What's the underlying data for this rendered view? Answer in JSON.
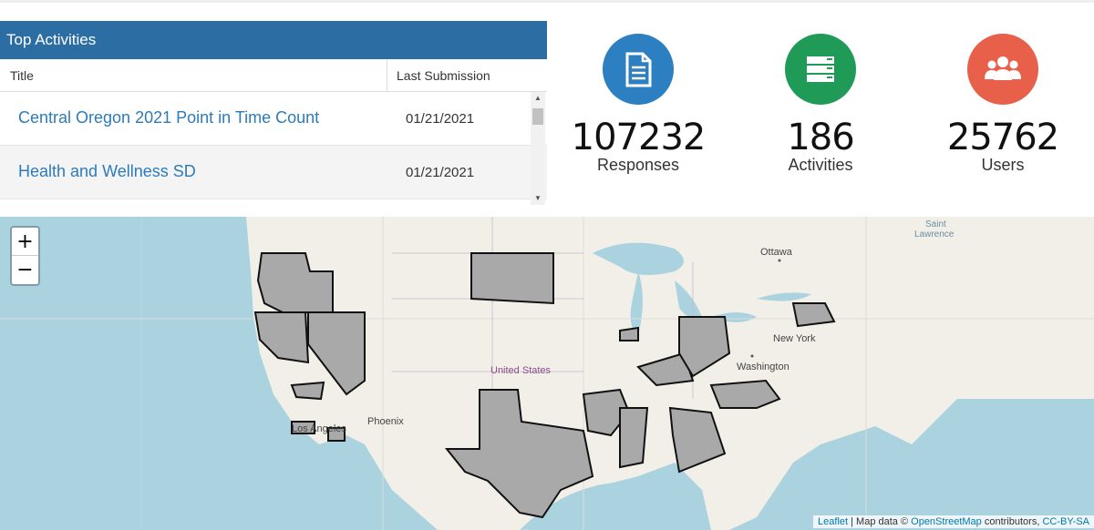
{
  "top_activities": {
    "title": "Top Activities",
    "columns": [
      "Title",
      "Last Submission"
    ],
    "rows": [
      {
        "title": "Central Oregon 2021 Point in Time Count",
        "last_submission": "01/21/2021"
      },
      {
        "title": "Health and Wellness SD",
        "last_submission": "01/21/2021"
      }
    ]
  },
  "stats": [
    {
      "value": "107232",
      "label": "Responses",
      "color": "#2c7fc1",
      "icon": "document-icon"
    },
    {
      "value": "186",
      "label": "Activities",
      "color": "#1f9b57",
      "icon": "list-icon"
    },
    {
      "value": "25762",
      "label": "Users",
      "color": "#e8604a",
      "icon": "users-icon"
    }
  ],
  "map": {
    "zoom_in": "+",
    "zoom_out": "−",
    "labels": {
      "ottawa": "Ottawa",
      "new_york": "New York",
      "washington": "Washington",
      "united_states": "United States",
      "phoenix": "Phoenix",
      "los_angeles": "Los Angeles",
      "saint_lawrence_1": "Saint",
      "saint_lawrence_2": "Lawrence"
    },
    "attribution": {
      "leaflet": "Leaflet",
      "sep": " | Map data © ",
      "osm": "OpenStreetMap",
      "contributors": " contributors, ",
      "license": "CC-BY-SA"
    }
  }
}
